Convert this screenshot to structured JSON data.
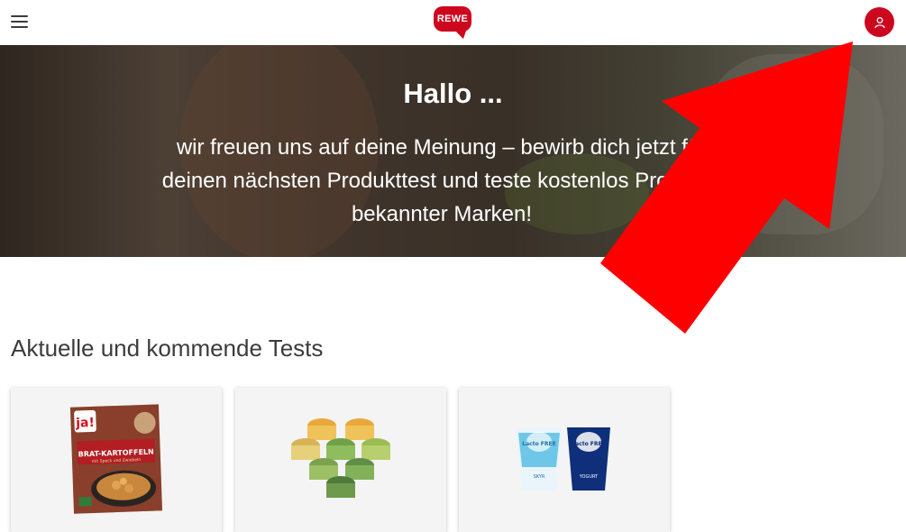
{
  "header": {
    "menu_icon": "hamburger-menu-icon",
    "logo_text": "REWE",
    "account_icon": "user-icon",
    "brand_color": "#cc071e"
  },
  "hero": {
    "title": "Hallo ...",
    "text": "wir freuen uns auf deine Meinung – bewirb dich jetzt für deinen nächsten Produkttest und teste kostenlos Produkte bekannter Marken!"
  },
  "tests": {
    "heading": "Aktuelle und kommende Tests",
    "items": [
      {
        "package_brand": "ja!",
        "package_title": "BRAT-KARTOFFELN",
        "package_subtitle": "mit Speck und Zwiebeln"
      },
      {
        "package_brand": ""
      },
      {
        "package_brand": "Lacto FREE",
        "package_labels": [
          "SKYR",
          "YOGURT"
        ]
      }
    ]
  },
  "annotation": {
    "arrow_color": "#ff0000"
  }
}
